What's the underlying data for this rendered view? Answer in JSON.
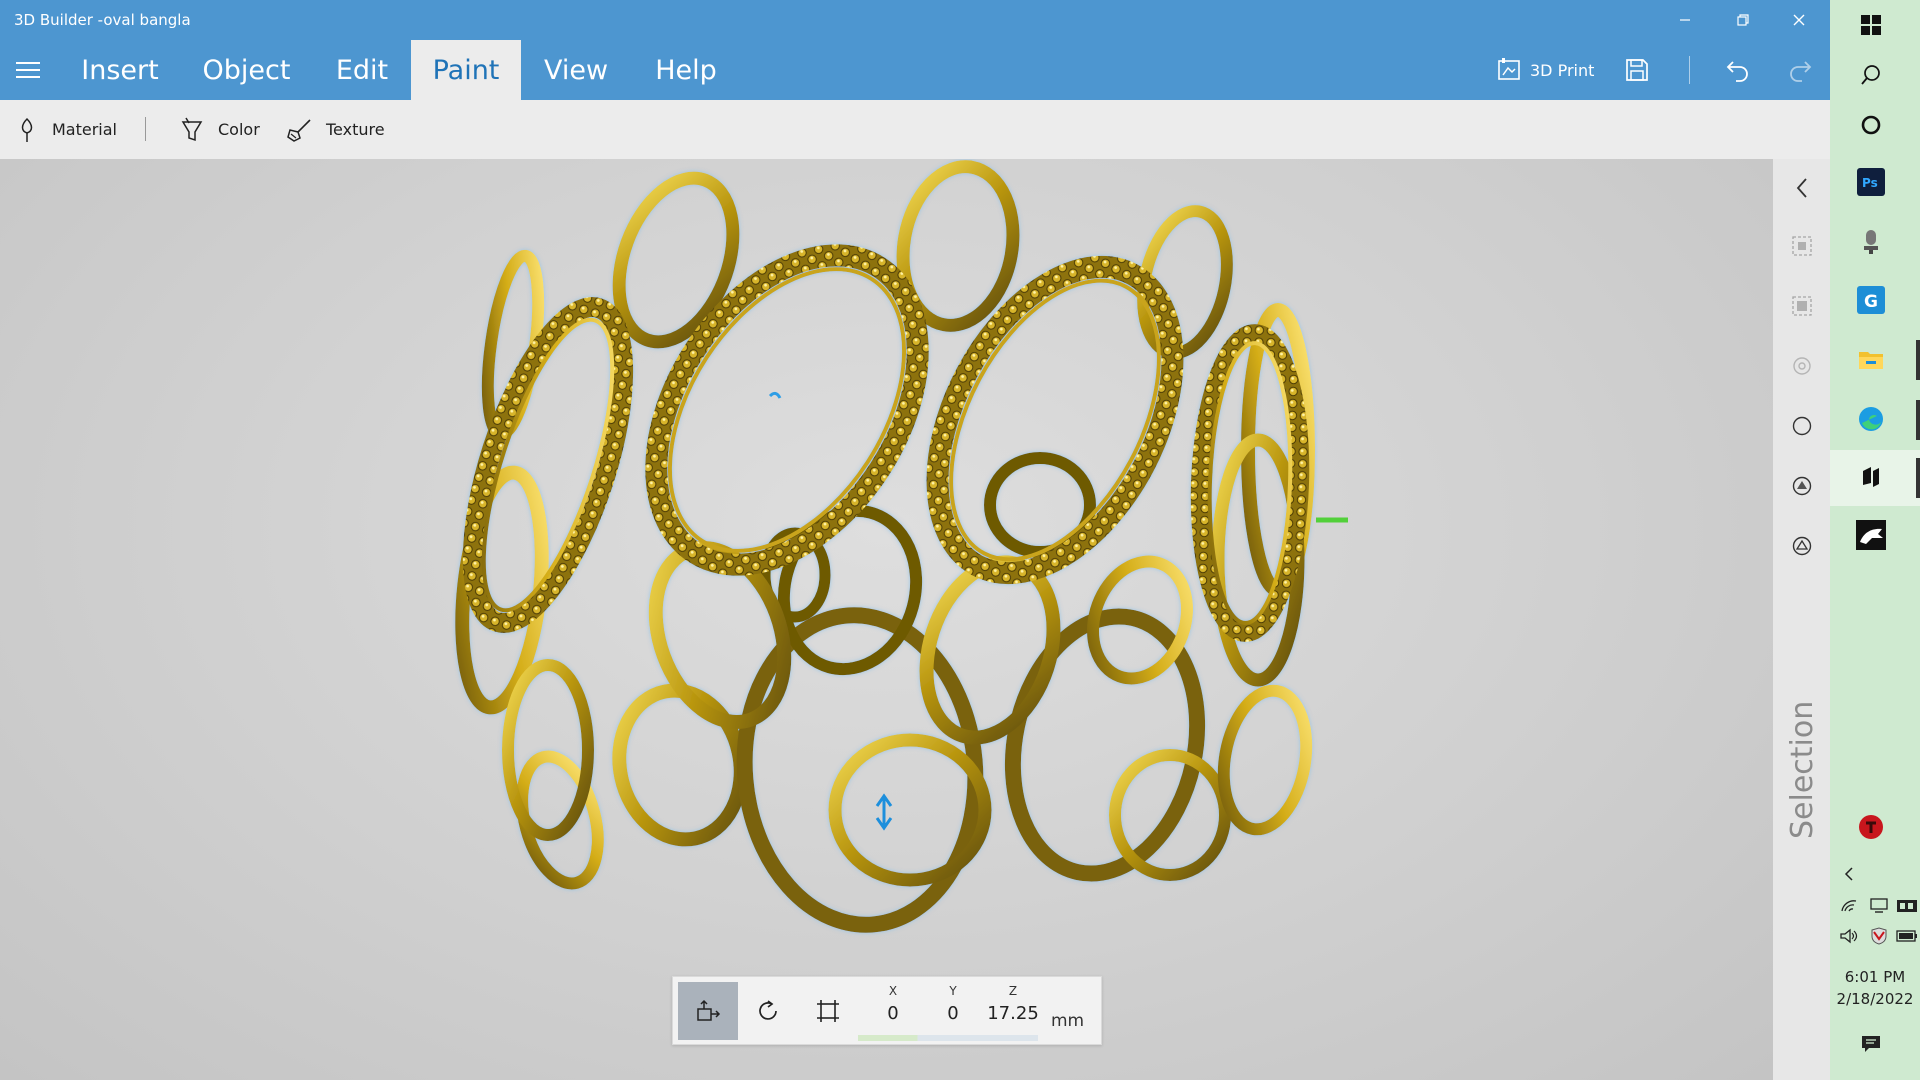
{
  "window": {
    "title": "3D Builder -oval bangla"
  },
  "menu": {
    "tabs": [
      {
        "label": "Insert"
      },
      {
        "label": "Object"
      },
      {
        "label": "Edit"
      },
      {
        "label": "Paint",
        "active": true
      },
      {
        "label": "View"
      },
      {
        "label": "Help"
      }
    ],
    "print_label": "3D Print"
  },
  "paint_toolbar": {
    "material": "Material",
    "color": "Color",
    "texture": "Texture"
  },
  "side_panel": {
    "label": "Selection"
  },
  "transform": {
    "x_axis": "X",
    "y_axis": "Y",
    "z_axis": "Z",
    "x": "0",
    "y": "0",
    "z": "17.25",
    "unit": "mm"
  },
  "taskbar": {
    "time": "6:01 PM",
    "date": "2/18/2022"
  },
  "colors": {
    "titlebar": "#4d96d0",
    "active_tab_text": "#1f73b7",
    "viewport": "#d2d2d2",
    "gold_dark": "#6e5a06",
    "gold_light": "#f4d84a",
    "taskbar": "#cfead0"
  }
}
